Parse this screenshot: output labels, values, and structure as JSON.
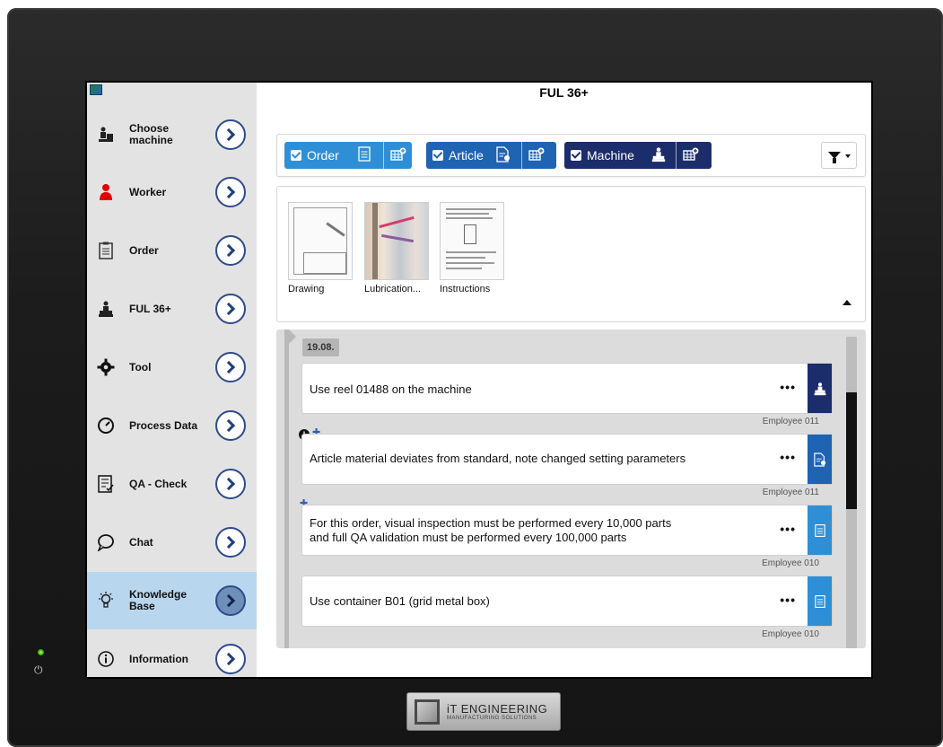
{
  "header": {
    "title": "FUL 36+"
  },
  "sidebar": {
    "items": [
      {
        "label": "Choose machine",
        "icon": "machine-operator-icon"
      },
      {
        "label": "Worker",
        "icon": "worker-icon"
      },
      {
        "label": "Order",
        "icon": "clipboard-icon"
      },
      {
        "label": "FUL 36+",
        "icon": "machine-operator-icon"
      },
      {
        "label": "Tool",
        "icon": "gear-icon"
      },
      {
        "label": "Process Data",
        "icon": "gauge-icon"
      },
      {
        "label": "QA - Check",
        "icon": "checklist-icon"
      },
      {
        "label": "Chat",
        "icon": "chat-bubble-icon"
      },
      {
        "label": "Knowledge Base",
        "icon": "lightbulb-icon",
        "active": true
      },
      {
        "label": "Information",
        "icon": "info-icon"
      }
    ]
  },
  "filters": {
    "chips": [
      {
        "label": "Order",
        "checked": true,
        "color": "#2f8fd6"
      },
      {
        "label": "Article",
        "checked": true,
        "color": "#1f63b3"
      },
      {
        "label": "Machine",
        "checked": true,
        "color": "#1b2d6b"
      }
    ]
  },
  "documents": [
    {
      "name": "Drawing"
    },
    {
      "name": "Lubrication..."
    },
    {
      "name": "Instructions"
    }
  ],
  "notes": {
    "date": "19.08.",
    "items": [
      {
        "text": "Use reel 01488 on the machine",
        "author": "Employee 011",
        "category": "machine",
        "color": "#1b2d6b"
      },
      {
        "text": "Article material deviates from standard, note changed setting parameters",
        "author": "Employee 011",
        "category": "article",
        "color": "#1f63b3",
        "important": true,
        "pinned": true
      },
      {
        "text_line1": "For this order, visual inspection must be performed every 10,000 parts",
        "text_line2": "and full QA validation must be performed every 100,000 parts",
        "author": "Employee 010",
        "category": "order",
        "color": "#2f8fd6",
        "pinned": true
      },
      {
        "text": "Use container B01 (grid metal box)",
        "author": "Employee 010",
        "category": "order",
        "color": "#2f8fd6"
      }
    ],
    "more_label": "•••"
  },
  "brand": {
    "line1": "iT ENGINEERING",
    "line2": "MANUFACTURING SOLUTIONS"
  }
}
